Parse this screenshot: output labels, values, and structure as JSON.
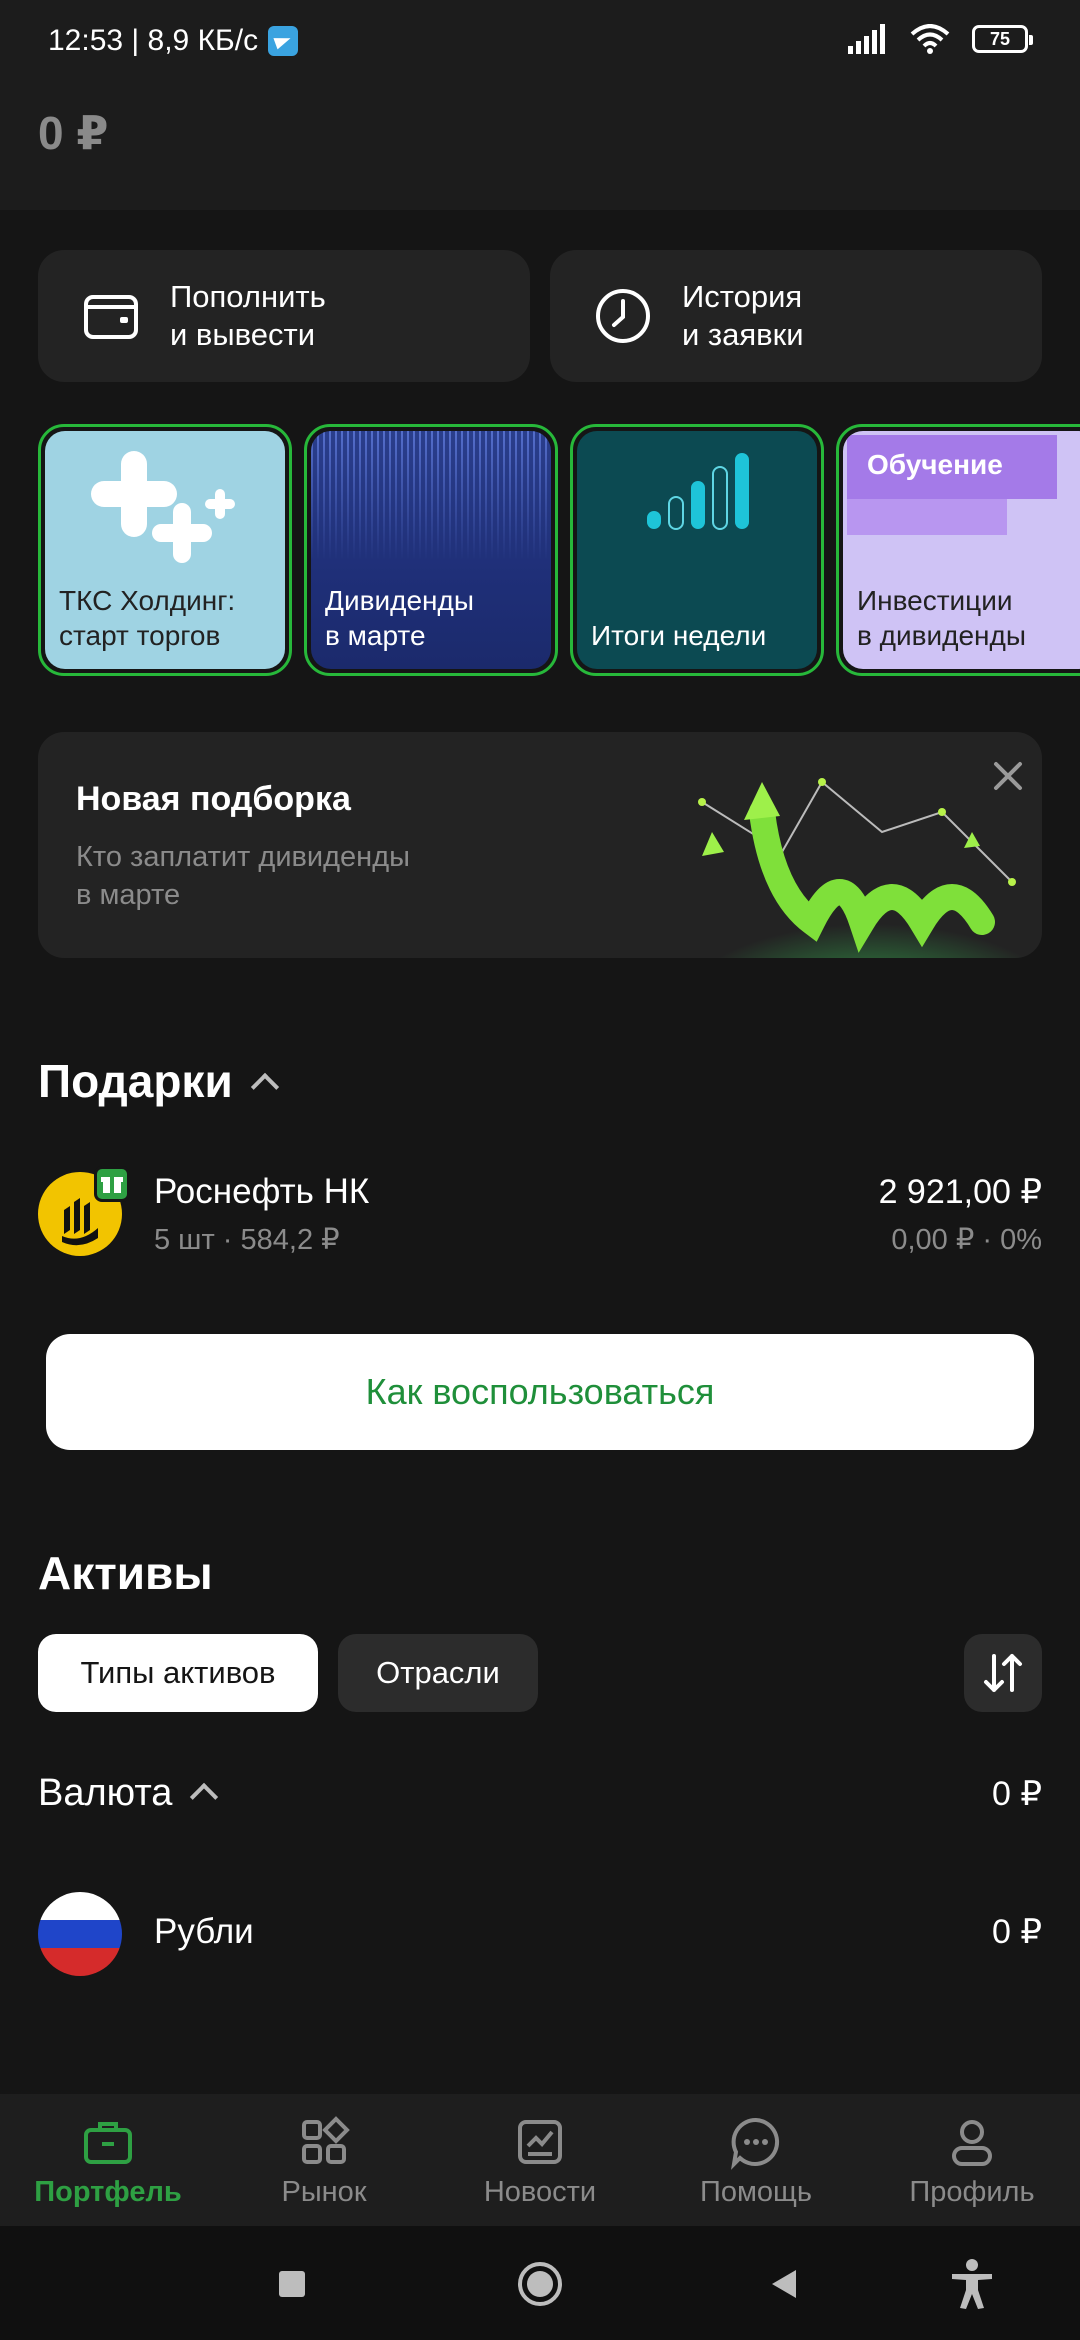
{
  "status_bar": {
    "time_speed": "12:53 | 8,9 КБ/с",
    "battery": "75"
  },
  "header": {
    "balance": "0 ₽"
  },
  "actions": [
    {
      "label": "Пополнить\nи вывести",
      "icon": "wallet-icon"
    },
    {
      "label": "История\nи заявки",
      "icon": "clock-icon"
    }
  ],
  "stories": [
    {
      "label": "ТКС Холдинг:\nстарт торгов"
    },
    {
      "label": "Дивиденды\nв марте"
    },
    {
      "label": "Итоги недели"
    },
    {
      "label": "Инвестиции\nв дивиденды",
      "tag": "Обучение"
    }
  ],
  "promo": {
    "title": "Новая подборка",
    "subtitle": "Кто заплатит дивиденды\nв марте"
  },
  "gifts": {
    "title": "Подарки",
    "item": {
      "name": "Роснефть НК",
      "details": "5 шт · 584,2 ₽",
      "price": "2 921,00 ₽",
      "change": "0,00 ₽ · 0%"
    },
    "howto_label": "Как воспользоваться"
  },
  "assets": {
    "title": "Активы",
    "chips": [
      "Типы активов",
      "Отрасли"
    ],
    "currency_title": "Валюта",
    "currency_total": "0 ₽",
    "rub_name": "Рубли",
    "rub_value": "0 ₽"
  },
  "bottom_nav": [
    {
      "label": "Портфель",
      "active": true
    },
    {
      "label": "Рынок",
      "active": false
    },
    {
      "label": "Новости",
      "active": false
    },
    {
      "label": "Помощь",
      "active": false
    },
    {
      "label": "Профиль",
      "active": false
    }
  ],
  "colors": {
    "accent_green": "#2ea043",
    "background": "#151515",
    "card": "#232323"
  }
}
